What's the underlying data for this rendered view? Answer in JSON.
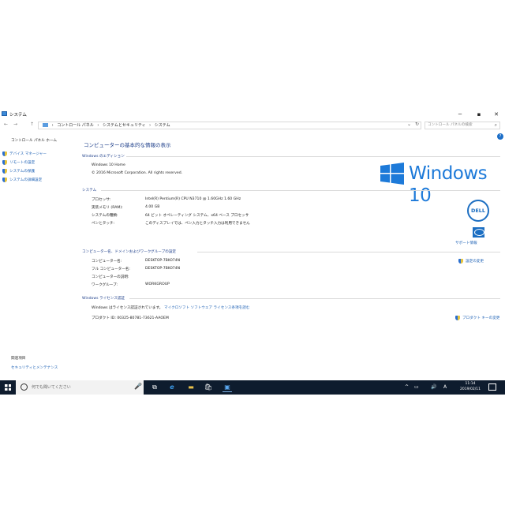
{
  "window": {
    "title": "システム",
    "minimize": "─",
    "maximize": "▪",
    "close": "✕"
  },
  "addressbar": {
    "back": "←",
    "forward": "→",
    "up": "↑",
    "crumbs": [
      "›",
      "コントロール パネル",
      "›",
      "システムとセキュリティ",
      "›",
      "システム"
    ],
    "dropdown": "⌄",
    "refresh": "↻",
    "search_placeholder": "コントロール パネルの検索",
    "search_icon": "⌕"
  },
  "leftpane": {
    "home": "コントロール パネル ホーム",
    "items": [
      "デバイス マネージャー",
      "リモートの設定",
      "システムの保護",
      "システムの詳細設定"
    ],
    "related_heading": "関連項目",
    "related_link": "セキュリティとメンテナンス"
  },
  "main": {
    "help": "?",
    "title": "コンピューターの基本的な情報の表示",
    "edition": {
      "heading": "Windows のエディション",
      "name": "Windows 10 Home",
      "copyright": "© 2016 Microsoft Corporation. All rights reserved.",
      "logo_text": "Windows 10"
    },
    "system": {
      "heading": "システム",
      "rows": [
        {
          "label": "プロセッサ:",
          "value": "Intel(R) Pentium(R) CPU  N3710  @ 1.60GHz   1.60 GHz"
        },
        {
          "label": "実装メモリ (RAM):",
          "value": "4.00 GB"
        },
        {
          "label": "システムの種類:",
          "value": "64 ビット オペレーティング システム、x64 ベース プロセッサ"
        },
        {
          "label": "ペンとタッチ:",
          "value": "このディスプレイでは、ペン入力とタッチ入力は利用できません"
        }
      ],
      "dell_logo": "DELL",
      "support_link": "サポート情報"
    },
    "computer": {
      "heading": "コンピューター名、ドメインおよびワークグループの設定",
      "rows": [
        {
          "label": "コンピューター名:",
          "value": "DESKTOP-7BK074N"
        },
        {
          "label": "フル コンピューター名:",
          "value": "DESKTOP-7BK074N"
        },
        {
          "label": "コンピューターの説明:",
          "value": ""
        },
        {
          "label": "ワークグループ:",
          "value": "WORKGROUP"
        }
      ],
      "change_link": "設定の変更"
    },
    "license": {
      "heading": "Windows ライセンス認証",
      "status": "Windows はライセンス認証されています。",
      "terms_link": "マイクロソフト ソフトウェア ライセンス条項を読む",
      "product_id": "プロダクト ID: 00325-80781-73621-AAOEM",
      "change_key_link": "プロダクト キーの変更"
    }
  },
  "taskbar": {
    "search_placeholder": "何でも聞いてください",
    "mic": "🎤",
    "icons": [
      "⧉",
      "e",
      "▬",
      "🛍",
      "▣"
    ],
    "tray": [
      "^",
      "▭",
      "🔊",
      "A"
    ],
    "time": "11:14",
    "date": "2019/02/11"
  }
}
